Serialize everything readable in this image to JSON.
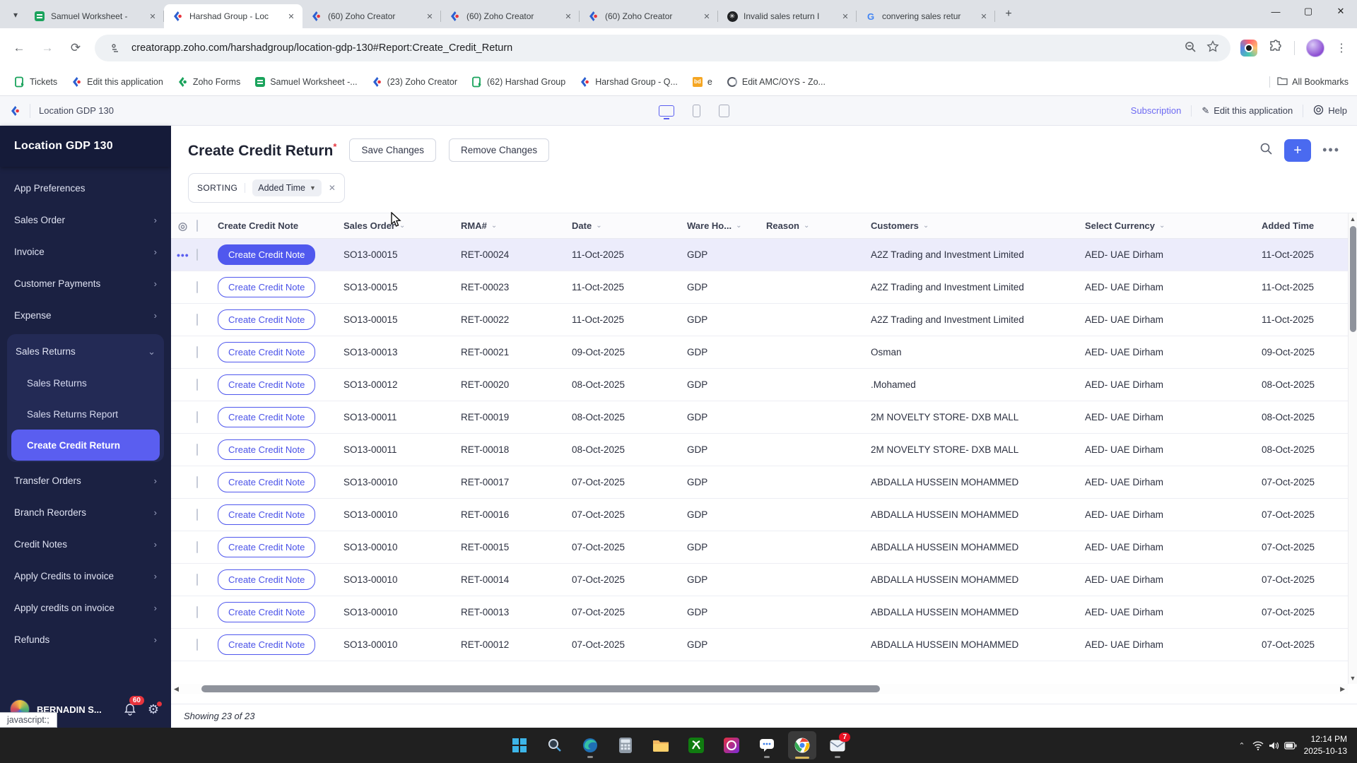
{
  "browser": {
    "tabs": [
      {
        "title": "Samuel Worksheet - ",
        "icon": "zoho-sheet",
        "active": false
      },
      {
        "title": "Harshad Group -  Loc",
        "icon": "zoho-creator",
        "active": true
      },
      {
        "title": "(60) Zoho Creator",
        "icon": "zoho-creator",
        "active": false
      },
      {
        "title": "(60) Zoho Creator",
        "icon": "zoho-creator",
        "active": false
      },
      {
        "title": "(60) Zoho Creator",
        "icon": "zoho-creator",
        "active": false
      },
      {
        "title": "Invalid sales return I",
        "icon": "chatgpt",
        "active": false
      },
      {
        "title": "convering sales retur",
        "icon": "google",
        "active": false
      }
    ],
    "url": "creatorapp.zoho.com/harshadgroup/location-gdp-130#Report:Create_Credit_Return",
    "bookmarks": [
      {
        "label": "Tickets",
        "icon": "zoho-desk"
      },
      {
        "label": "Edit this application",
        "icon": "zoho-creator"
      },
      {
        "label": "Zoho Forms",
        "icon": "zoho-forms"
      },
      {
        "label": "Samuel Worksheet -...",
        "icon": "zoho-sheet"
      },
      {
        "label": "(23) Zoho Creator",
        "icon": "zoho-creator"
      },
      {
        "label": "(62) Harshad Group",
        "icon": "zoho-desk"
      },
      {
        "label": "Harshad Group -  Q...",
        "icon": "zoho-creator"
      },
      {
        "label": "e",
        "icon": "orange-site"
      },
      {
        "label": "Edit AMC/OYS - Zo...",
        "icon": "zoho-one"
      }
    ],
    "all_bookmarks_label": "All Bookmarks"
  },
  "topbar": {
    "app_name": "Location GDP 130",
    "subscription_label": "Subscription",
    "edit_app_label": "Edit this application",
    "help_label": "Help"
  },
  "sidebar": {
    "title": "Location GDP 130",
    "items": [
      {
        "label": "App Preferences",
        "chevron": "none"
      },
      {
        "label": "Sales Order",
        "chevron": "right"
      },
      {
        "label": "Invoice",
        "chevron": "right"
      },
      {
        "label": "Customer Payments",
        "chevron": "right"
      },
      {
        "label": "Expense",
        "chevron": "right"
      },
      {
        "label": "Sales Returns",
        "chevron": "down",
        "group": true,
        "children": [
          {
            "label": "Sales Returns",
            "selected": false
          },
          {
            "label": "Sales Returns Report",
            "selected": false
          },
          {
            "label": "Create Credit Return",
            "selected": true
          }
        ]
      },
      {
        "label": "Transfer Orders",
        "chevron": "right"
      },
      {
        "label": "Branch Reorders",
        "chevron": "right"
      },
      {
        "label": "Credit Notes",
        "chevron": "right"
      },
      {
        "label": "Apply Credits to invoice",
        "chevron": "right"
      },
      {
        "label": "Apply credits on invoice",
        "chevron": "right"
      },
      {
        "label": "Refunds",
        "chevron": "right"
      }
    ],
    "user": {
      "name": "BERNADIN S...",
      "notification_count": "60"
    }
  },
  "report": {
    "title": "Create Credit Return",
    "save_button": "Save Changes",
    "remove_button": "Remove Changes",
    "sorting_label": "SORTING",
    "sorting_value": "Added Time",
    "action_button_label": "Create Credit Note",
    "columns": [
      {
        "label": "Create Credit Note",
        "sortable": false
      },
      {
        "label": "Sales Order",
        "sortable": true
      },
      {
        "label": "RMA#",
        "sortable": true
      },
      {
        "label": "Date",
        "sortable": true
      },
      {
        "label": "Ware Ho...",
        "sortable": true
      },
      {
        "label": "Reason",
        "sortable": true
      },
      {
        "label": "Customers",
        "sortable": true
      },
      {
        "label": "Select Currency",
        "sortable": true
      },
      {
        "label": "Added Time",
        "sortable": false
      }
    ],
    "rows": [
      {
        "sales_order": "SO13-00015",
        "rma": "RET-00024",
        "date": "11-Oct-2025",
        "warehouse": "GDP",
        "reason": "",
        "customer": "A2Z Trading and Investment Limited",
        "currency": "AED- UAE Dirham",
        "added_time": "11-Oct-2025",
        "highlighted": true
      },
      {
        "sales_order": "SO13-00015",
        "rma": "RET-00023",
        "date": "11-Oct-2025",
        "warehouse": "GDP",
        "reason": "",
        "customer": "A2Z Trading and Investment Limited",
        "currency": "AED- UAE Dirham",
        "added_time": "11-Oct-2025",
        "highlighted": false
      },
      {
        "sales_order": "SO13-00015",
        "rma": "RET-00022",
        "date": "11-Oct-2025",
        "warehouse": "GDP",
        "reason": "",
        "customer": "A2Z Trading and Investment Limited",
        "currency": "AED- UAE Dirham",
        "added_time": "11-Oct-2025",
        "highlighted": false
      },
      {
        "sales_order": "SO13-00013",
        "rma": "RET-00021",
        "date": "09-Oct-2025",
        "warehouse": "GDP",
        "reason": "",
        "customer": "Osman",
        "currency": "AED- UAE Dirham",
        "added_time": "09-Oct-2025",
        "highlighted": false
      },
      {
        "sales_order": "SO13-00012",
        "rma": "RET-00020",
        "date": "08-Oct-2025",
        "warehouse": "GDP",
        "reason": "",
        "customer": ".Mohamed",
        "currency": "AED- UAE Dirham",
        "added_time": "08-Oct-2025",
        "highlighted": false
      },
      {
        "sales_order": "SO13-00011",
        "rma": "RET-00019",
        "date": "08-Oct-2025",
        "warehouse": "GDP",
        "reason": "",
        "customer": "2M NOVELTY STORE- DXB MALL",
        "currency": "AED- UAE Dirham",
        "added_time": "08-Oct-2025",
        "highlighted": false
      },
      {
        "sales_order": "SO13-00011",
        "rma": "RET-00018",
        "date": "08-Oct-2025",
        "warehouse": "GDP",
        "reason": "",
        "customer": "2M NOVELTY STORE- DXB MALL",
        "currency": "AED- UAE Dirham",
        "added_time": "08-Oct-2025",
        "highlighted": false
      },
      {
        "sales_order": "SO13-00010",
        "rma": "RET-00017",
        "date": "07-Oct-2025",
        "warehouse": "GDP",
        "reason": "",
        "customer": "ABDALLA HUSSEIN MOHAMMED",
        "currency": "AED- UAE Dirham",
        "added_time": "07-Oct-2025",
        "highlighted": false
      },
      {
        "sales_order": "SO13-00010",
        "rma": "RET-00016",
        "date": "07-Oct-2025",
        "warehouse": "GDP",
        "reason": "",
        "customer": "ABDALLA HUSSEIN MOHAMMED",
        "currency": "AED- UAE Dirham",
        "added_time": "07-Oct-2025",
        "highlighted": false
      },
      {
        "sales_order": "SO13-00010",
        "rma": "RET-00015",
        "date": "07-Oct-2025",
        "warehouse": "GDP",
        "reason": "",
        "customer": "ABDALLA HUSSEIN MOHAMMED",
        "currency": "AED- UAE Dirham",
        "added_time": "07-Oct-2025",
        "highlighted": false
      },
      {
        "sales_order": "SO13-00010",
        "rma": "RET-00014",
        "date": "07-Oct-2025",
        "warehouse": "GDP",
        "reason": "",
        "customer": "ABDALLA HUSSEIN MOHAMMED",
        "currency": "AED- UAE Dirham",
        "added_time": "07-Oct-2025",
        "highlighted": false
      },
      {
        "sales_order": "SO13-00010",
        "rma": "RET-00013",
        "date": "07-Oct-2025",
        "warehouse": "GDP",
        "reason": "",
        "customer": "ABDALLA HUSSEIN MOHAMMED",
        "currency": "AED- UAE Dirham",
        "added_time": "07-Oct-2025",
        "highlighted": false
      },
      {
        "sales_order": "SO13-00010",
        "rma": "RET-00012",
        "date": "07-Oct-2025",
        "warehouse": "GDP",
        "reason": "",
        "customer": "ABDALLA HUSSEIN MOHAMMED",
        "currency": "AED- UAE Dirham",
        "added_time": "07-Oct-2025",
        "highlighted": false
      }
    ],
    "footer": "Showing 23 of 23"
  },
  "status_tooltip": "javascript:;",
  "taskbar": {
    "icons": [
      {
        "name": "start",
        "badge": ""
      },
      {
        "name": "search",
        "badge": ""
      },
      {
        "name": "edge",
        "badge": ""
      },
      {
        "name": "calculator",
        "badge": ""
      },
      {
        "name": "file-explorer",
        "badge": ""
      },
      {
        "name": "xbox",
        "badge": ""
      },
      {
        "name": "paint-app",
        "badge": ""
      },
      {
        "name": "chat",
        "badge": ""
      },
      {
        "name": "chrome",
        "badge": "",
        "active": true
      },
      {
        "name": "mail",
        "badge": "7"
      }
    ],
    "time": "12:14 PM",
    "date": "2025-10-13"
  },
  "colors": {
    "accent_blue": "#4a6af0",
    "button_indigo": "#5058ee",
    "sidebar_navy": "#1b2142",
    "selected_purple": "#5a5ef0",
    "badge_red": "#e8343d"
  }
}
